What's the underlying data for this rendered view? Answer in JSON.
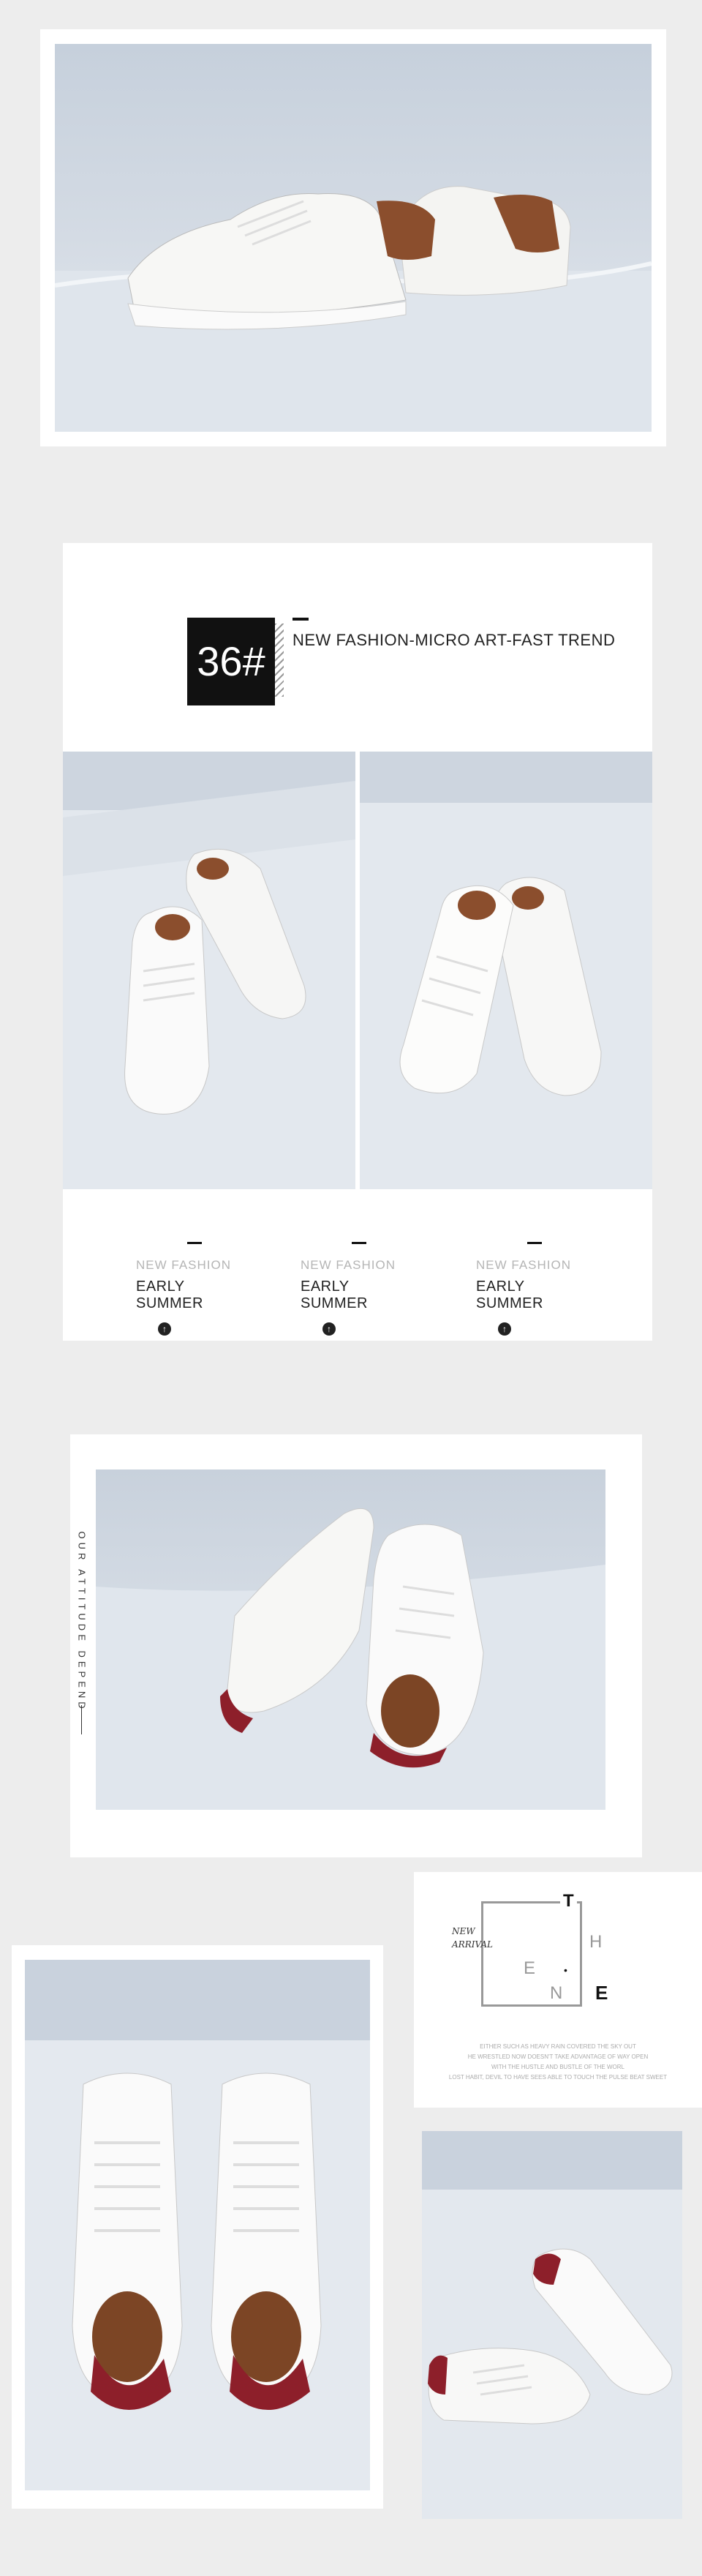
{
  "colors": {
    "background": "#ededed",
    "card": "#ffffff",
    "sky": "#c9d3df",
    "floor": "#e6ebf1",
    "leather_brown": "#8b4e2d",
    "leather_red": "#8d1f2a"
  },
  "section2": {
    "size_badge": "36#",
    "tagline": "NEW FASHION-MICRO ART-FAST TREND",
    "subtitles": [
      {
        "label": "NEW FASHION",
        "value": "EARLY SUMMER",
        "icon": "up-arrow-icon"
      },
      {
        "label": "NEW FASHION",
        "value": "EARLY SUMMER",
        "icon": "up-arrow-icon"
      },
      {
        "label": "NEW FASHION",
        "value": "EARLY SUMMER",
        "icon": "up-arrow-icon"
      }
    ]
  },
  "section3": {
    "vertical_text": "OUR ATTITUDE DEPEND"
  },
  "section4": {
    "new_arrival": "NEW\nARRIVAL",
    "letters": {
      "t": "T",
      "h": "H",
      "e1": "E",
      "dot": "•",
      "n": "N",
      "e2": "E"
    },
    "body_lines": [
      "EITHER SUCH AS HEAVY RAIN COVERED THE SKY OUT",
      "HE WRESTLED NOW DOESN'T TAKE ADVANTAGE OF WAY OPEN",
      "WITH THE HUSTLE AND BUSTLE OF THE WORL",
      "LOST HABIT, DEVIL TO HAVE SEES ABLE TO TOUCH THE PULSE BEAT SWEET"
    ]
  }
}
